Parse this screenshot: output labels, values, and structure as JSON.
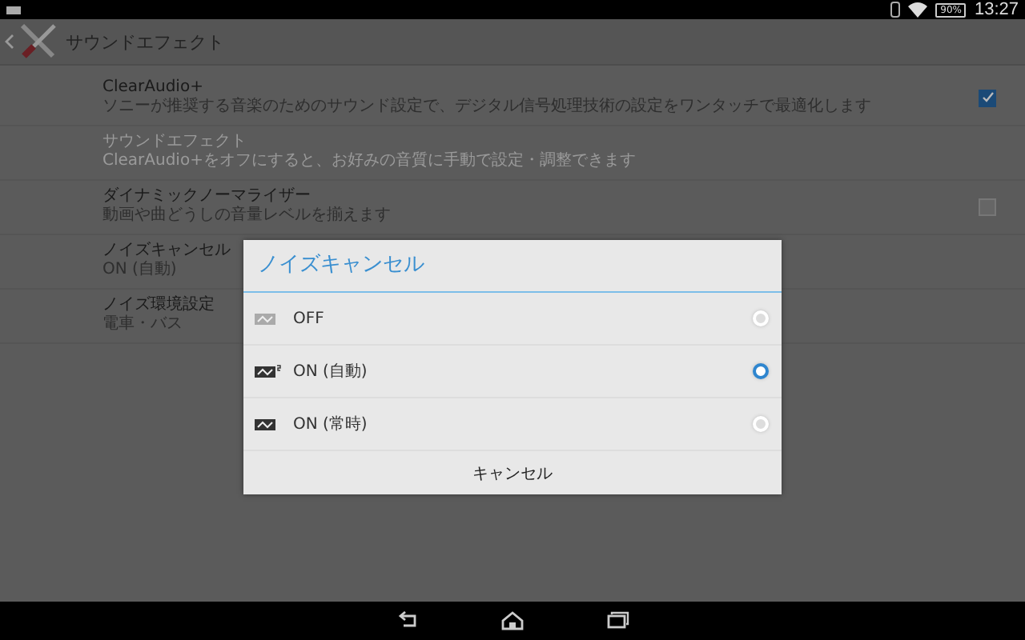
{
  "status_bar": {
    "battery": "90%",
    "time": "13:27"
  },
  "action_bar": {
    "title": "サウンドエフェクト"
  },
  "settings": [
    {
      "kind": "checkbox",
      "title": "ClearAudio+",
      "summary": "ソニーが推奨する音楽のためのサウンド設定で、デジタル信号処理技術の設定をワンタッチで最適化します",
      "disabled": false,
      "checked": true
    },
    {
      "kind": "plain",
      "title": "サウンドエフェクト",
      "summary": "ClearAudio+をオフにすると、お好みの音質に手動で設定・調整できます",
      "disabled": true
    },
    {
      "kind": "checkbox",
      "title": "ダイナミックノーマライザー",
      "summary": "動画や曲どうしの音量レベルを揃えます",
      "disabled": false,
      "checked": false
    },
    {
      "kind": "plain",
      "title": "ノイズキャンセル",
      "summary": "ON (自動)",
      "disabled": false
    },
    {
      "kind": "plain",
      "title": "ノイズ環境設定",
      "summary": "電車・バス",
      "disabled": false
    }
  ],
  "dialog": {
    "title": "ノイズキャンセル",
    "options": [
      {
        "kind": "off",
        "label": "OFF",
        "selected": false
      },
      {
        "kind": "auto",
        "label": "ON (自動)",
        "selected": true
      },
      {
        "kind": "always",
        "label": "ON (常時)",
        "selected": false
      }
    ],
    "cancel": "キャンセル"
  }
}
